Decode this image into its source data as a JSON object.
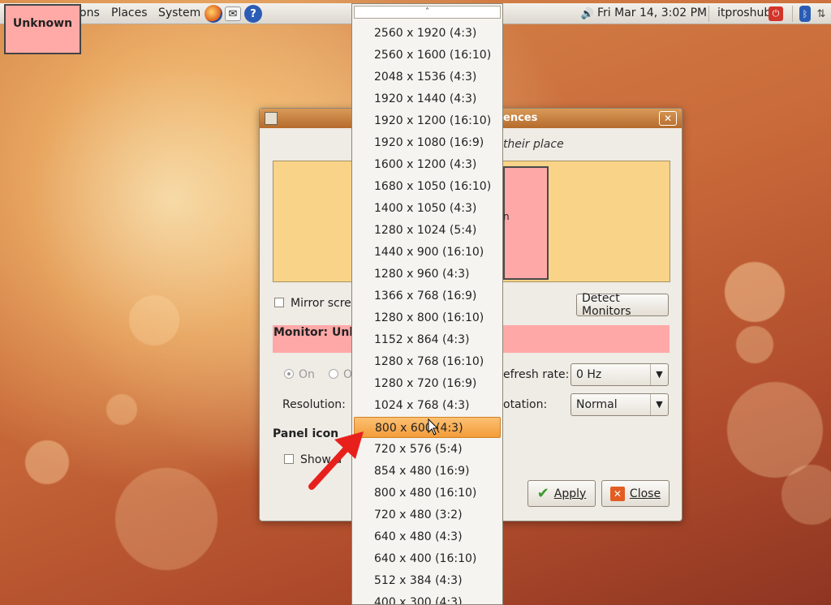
{
  "top_panel": {
    "menus": [
      "ons",
      "Places",
      "System"
    ],
    "clock": "Fri Mar 14,  3:02 PM",
    "user": "itproshub"
  },
  "overlay_label": "Unknown",
  "dialog": {
    "title": "ences",
    "hint": "t their place",
    "monitor_text": "n",
    "mirror_label": "Mirror scree",
    "detect_button": "Detect Monitors",
    "monitor_label": "Monitor: Unk",
    "on_label": "On",
    "off_label": "O",
    "refresh_label": "efresh rate:",
    "refresh_value": "0 Hz",
    "resolution_label": "Resolution:",
    "rotation_label": "otation:",
    "rotation_value": "Normal",
    "panel_icon_heading": "Panel icon",
    "show_display_label": "Show d",
    "apply_button": "Apply",
    "close_button": "Close"
  },
  "resolution_dropdown": {
    "scroll_up_glyph": "˄",
    "selected_index": 18,
    "items": [
      "2560 x 1920 (4:3)",
      "2560 x 1600 (16:10)",
      "2048 x 1536 (4:3)",
      "1920 x 1440 (4:3)",
      "1920 x 1200 (16:10)",
      "1920 x 1080 (16:9)",
      "1600 x 1200 (4:3)",
      "1680 x 1050 (16:10)",
      "1400 x 1050 (4:3)",
      "1280 x 1024 (5:4)",
      "1440 x 900 (16:10)",
      "1280 x 960 (4:3)",
      "1366 x 768 (16:9)",
      "1280 x 800 (16:10)",
      "1152 x 864 (4:3)",
      "1280 x 768 (16:10)",
      "1280 x 720 (16:9)",
      "1024 x 768 (4:3)",
      "800 x 600 (4:3)",
      "720 x 576 (5:4)",
      "854 x 480 (16:9)",
      "800 x 480 (16:10)",
      "720 x 480 (3:2)",
      "640 x 480 (4:3)",
      "640 x 400 (16:10)",
      "512 x 384 (4:3)",
      "400 x 300 (4:3)"
    ]
  },
  "colors": {
    "accent_arrow": "#e8201c",
    "selection": "#f39c3a",
    "monitor_pink": "#ffa8a8",
    "monitor_area": "#f9d387"
  }
}
